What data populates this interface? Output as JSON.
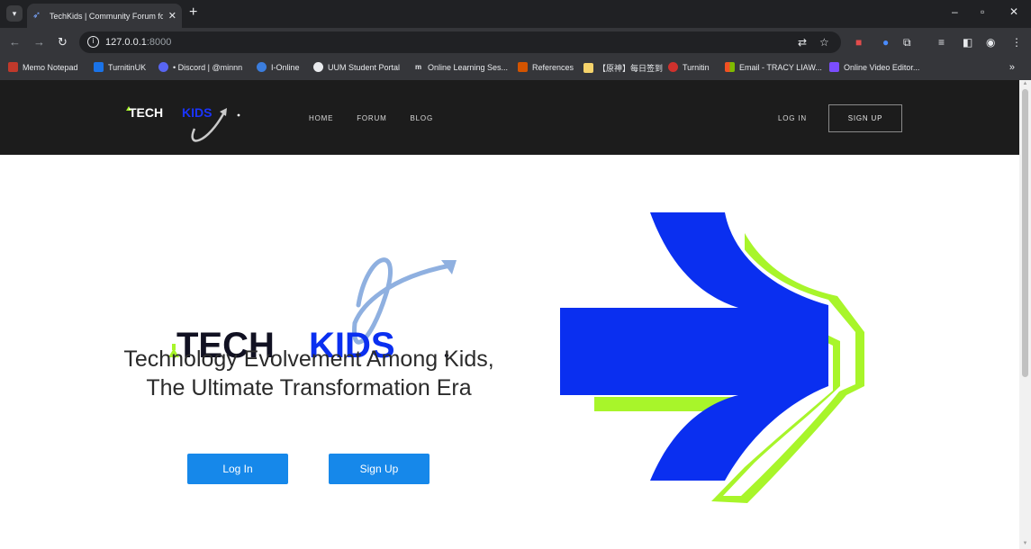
{
  "browser": {
    "tab_title": "TechKids | Community Forum fo",
    "url_host": "127.0.0.1",
    "url_port": ":8000",
    "bookmarks": [
      {
        "label": "Memo Notepad",
        "color": "#c0392b"
      },
      {
        "label": "TurnitinUK",
        "color": "#1a73e8"
      },
      {
        "label": "• Discord | @minnn",
        "color": "#5865f2"
      },
      {
        "label": "I-Online",
        "color": "#3b7ddd"
      },
      {
        "label": "UUM Student Portal",
        "color": "#e8eaed"
      },
      {
        "label": "Online Learning Ses...",
        "color": "#e8eaed"
      },
      {
        "label": "References",
        "color": "#d35400"
      },
      {
        "label": "【原神】每日签到",
        "color": "#f5d36b"
      },
      {
        "label": "Turnitin",
        "color": "#d0312d"
      },
      {
        "label": "Email - TRACY LIAW...",
        "color": "#f25022"
      },
      {
        "label": "Online Video Editor...",
        "color": "#7b4dff"
      }
    ]
  },
  "header": {
    "logo_text_tech": "TECH",
    "logo_text_kids": "KIDS",
    "nav": [
      "HOME",
      "FORUM",
      "BLOG"
    ],
    "login": "LOG IN",
    "signup": "SIGN UP"
  },
  "hero": {
    "logo_text_tech": "TECH",
    "logo_text_kids": "KIDS",
    "tagline": "Technology Evolvement Among Kids, The Ultimate Transformation Era",
    "login_button": "Log In",
    "signup_button": "Sign Up"
  },
  "colors": {
    "brand_blue": "#0a2ff0",
    "brand_lime": "#a8f52a",
    "button_blue": "#1688ea",
    "header_bg": "#1c1c1c"
  }
}
